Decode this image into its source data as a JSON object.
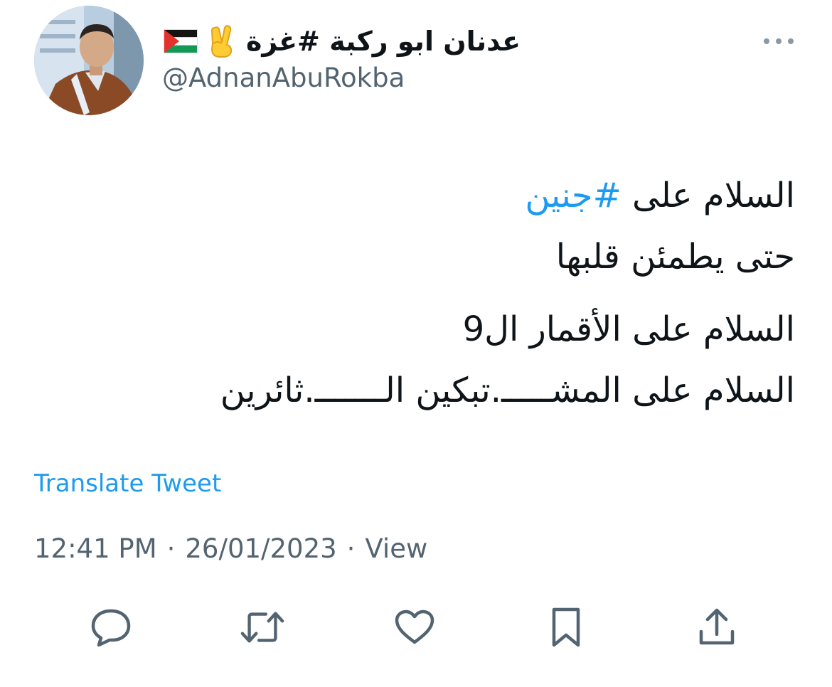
{
  "author": {
    "display_name": "عدنان ابو ركبة #غزة",
    "handle": "@AdnanAbuRokba",
    "emoji_icons": [
      "victory-hand-icon",
      "palestine-flag-icon"
    ]
  },
  "tweet": {
    "line1_prefix": "السلام على ",
    "line1_hashtag": "#جنين",
    "line2": "حتى يطمئن قلبها",
    "line3": "السلام على الأقمار ال9",
    "line4": "السلام على المشـــــ.تبكين الـــــــ.ثائرين"
  },
  "translate_label": "Translate Tweet",
  "meta": {
    "time": "12:41 PM",
    "separator": "·",
    "date": "26/01/2023",
    "view_label": "View"
  },
  "actions": [
    "reply-icon",
    "retweet-icon",
    "like-icon",
    "bookmark-icon",
    "share-icon"
  ],
  "colors": {
    "accent": "#1d9bf0",
    "text": "#0f1419",
    "secondary": "#536471"
  }
}
